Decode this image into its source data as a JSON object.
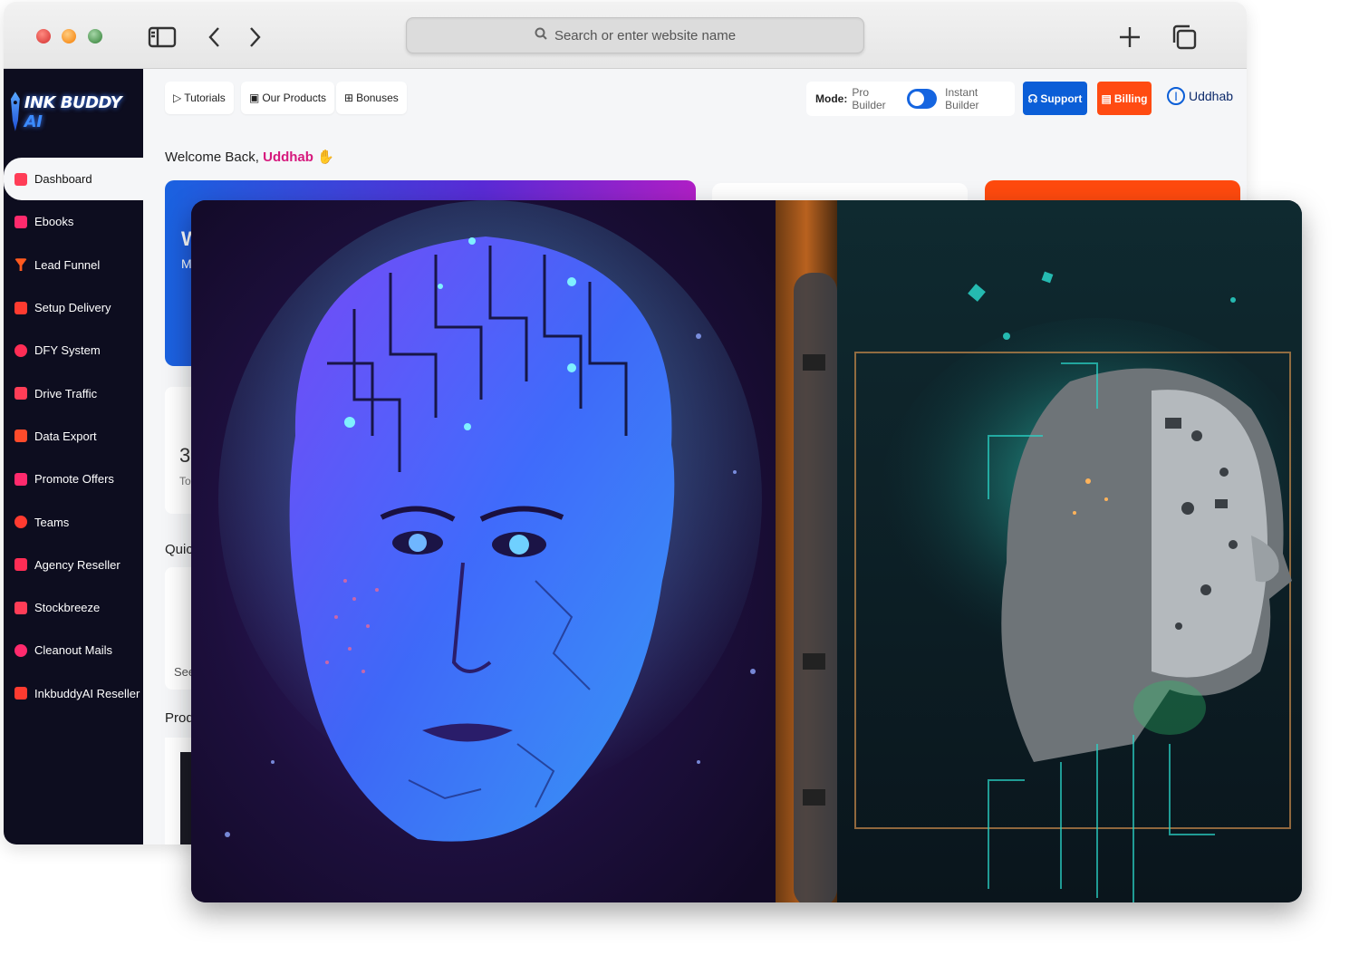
{
  "browser": {
    "address_placeholder": "Search or enter website name"
  },
  "brand": {
    "logo_main": "INK BUDDY",
    "logo_ai": "AI"
  },
  "sidebar": {
    "items": [
      {
        "label": "Dashboard",
        "icon": "grid-icon",
        "color": "#ff3d57",
        "active": true
      },
      {
        "label": "Ebooks",
        "icon": "book-icon",
        "color": "#ff2a6d"
      },
      {
        "label": "Lead Funnel",
        "icon": "funnel-icon",
        "color": "#ff5a1f"
      },
      {
        "label": "Setup Delivery",
        "icon": "tools-icon",
        "color": "#ff3b30"
      },
      {
        "label": "DFY System",
        "icon": "cart-icon",
        "color": "#ff2d55"
      },
      {
        "label": "Drive Traffic",
        "icon": "traffic-icon",
        "color": "#ff3d57"
      },
      {
        "label": "Data Export",
        "icon": "file-export-icon",
        "color": "#ff4b2b"
      },
      {
        "label": "Promote Offers",
        "icon": "gift-icon",
        "color": "#ff2a6d"
      },
      {
        "label": "Teams",
        "icon": "users-icon",
        "color": "#ff3b30"
      },
      {
        "label": "Agency Reseller",
        "icon": "briefcase-icon",
        "color": "#ff2d55"
      },
      {
        "label": "Stockbreeze",
        "icon": "sign-in-icon",
        "color": "#ff3d57"
      },
      {
        "label": "Cleanout Mails",
        "icon": "mail-icon",
        "color": "#ff2a6d"
      },
      {
        "label": "InkbuddyAI Reseller",
        "icon": "briefcase-icon",
        "color": "#ff3b30"
      }
    ]
  },
  "topbar": {
    "tutorials": "Tutorials",
    "products": "Our Products",
    "bonuses": "Bonuses",
    "mode_label": "Mode:",
    "mode_pro": "Pro Builder",
    "mode_instant": "Instant Builder",
    "support": "Support",
    "billing": "Billing",
    "user": "Uddhab"
  },
  "main": {
    "welcome_prefix": "Welcome Back,",
    "welcome_name": "Uddhab",
    "card_title_fragment": "W",
    "card_sub_fragment": "M",
    "stat_value_fragment": "3",
    "stat_label_fragment": "To",
    "quick_fragment": "Quic",
    "see_fragment": "See",
    "products_fragment": "Prod"
  },
  "colors": {
    "sidebar_bg": "#0d0d1f",
    "primary": "#0b5ed7",
    "billing": "#ff4b12",
    "accent_pink": "#d6197d"
  }
}
